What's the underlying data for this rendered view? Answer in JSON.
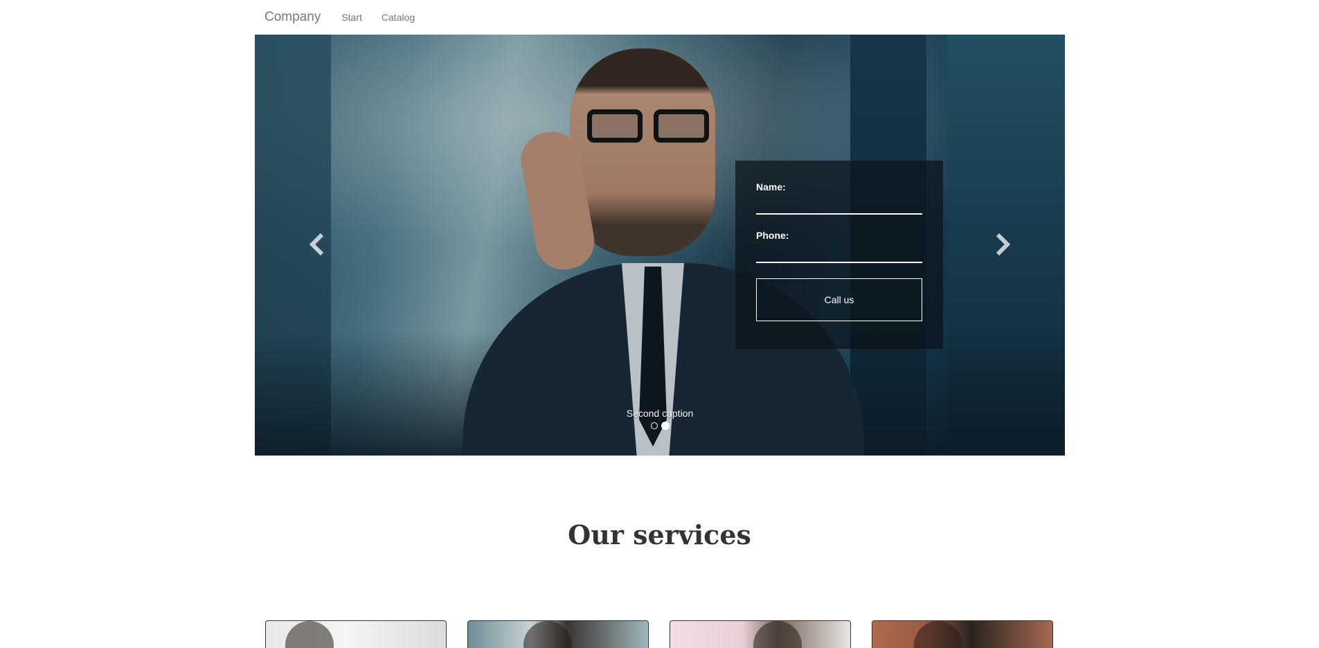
{
  "navbar": {
    "brand": "Company",
    "links": [
      "Start",
      "Catalog"
    ]
  },
  "carousel": {
    "caption": "Second caption",
    "slide_count": 2,
    "active_slide": 2,
    "prev_icon": "chevron-left-icon",
    "next_icon": "chevron-right-icon"
  },
  "callback_form": {
    "name_label": "Name:",
    "name_value": "",
    "phone_label": "Phone:",
    "phone_value": "",
    "submit_label": "Call us"
  },
  "services": {
    "title": "Our services",
    "card_count": 4
  }
}
